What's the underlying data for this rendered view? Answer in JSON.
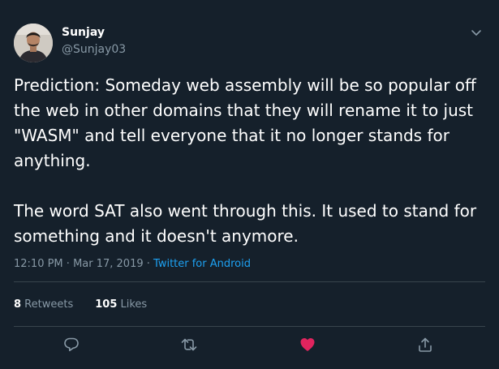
{
  "author": {
    "name": "Sunjay",
    "handle": "@Sunjay03"
  },
  "tweet": {
    "paragraphs": [
      "Prediction: Someday web assembly will be so popular off the web in other domains that they will rename it to just \"WASM\" and tell everyone that it no longer stands for anything.",
      "The word SAT also went through this. It used to stand for something and it doesn't anymore."
    ]
  },
  "meta": {
    "time": "12:10 PM",
    "separator1": " · ",
    "date": "Mar 17, 2019",
    "separator2": " · ",
    "source": "Twitter for Android"
  },
  "stats": {
    "retweets_count": "8",
    "retweets_label": " Retweets",
    "likes_count": "105",
    "likes_label": " Likes"
  },
  "icons": {
    "caret": "chevron-down-icon",
    "reply": "reply-icon",
    "retweet": "retweet-icon",
    "like": "heart-icon",
    "share": "share-icon"
  },
  "colors": {
    "background": "#15202b",
    "text": "#ffffff",
    "secondary": "#8899a6",
    "accent": "#1da1f2",
    "like": "#e0245e",
    "divider": "#38444d"
  }
}
